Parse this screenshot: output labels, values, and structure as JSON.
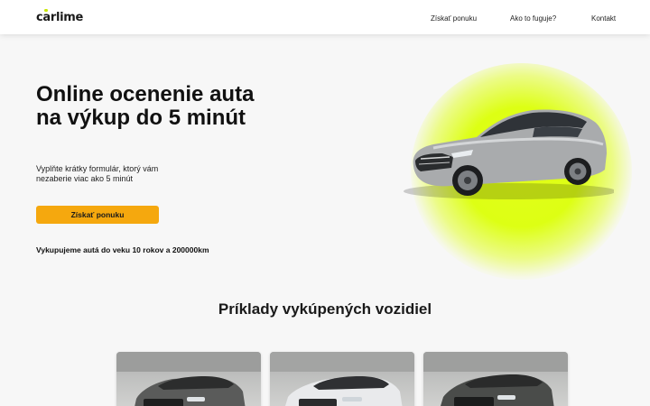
{
  "header": {
    "logo": "carlime",
    "nav": [
      {
        "label": "Získať ponuku"
      },
      {
        "label": "Ako to fuguje?"
      },
      {
        "label": "Kontakt"
      }
    ]
  },
  "hero": {
    "title_bold_1": "Online ocenenie",
    "title_normal_1": "auta",
    "title_line_2": "na výkup do 5 minút",
    "subtitle": "Vyplňte krátky formulár, ktorý vám nezaberie viac ako 5 minút",
    "cta_label": "Získať ponuku",
    "note": "Vykupujeme autá do veku 10 rokov a 200000km",
    "accent_color": "#ddff14",
    "cta_color": "#f5a80e"
  },
  "examples": {
    "title": "Príklady vykúpených vozidiel",
    "cards": [
      {
        "car_color": "#5a5b5a"
      },
      {
        "car_color": "#e9eaec"
      },
      {
        "car_color": "#4a4c4a"
      }
    ]
  }
}
